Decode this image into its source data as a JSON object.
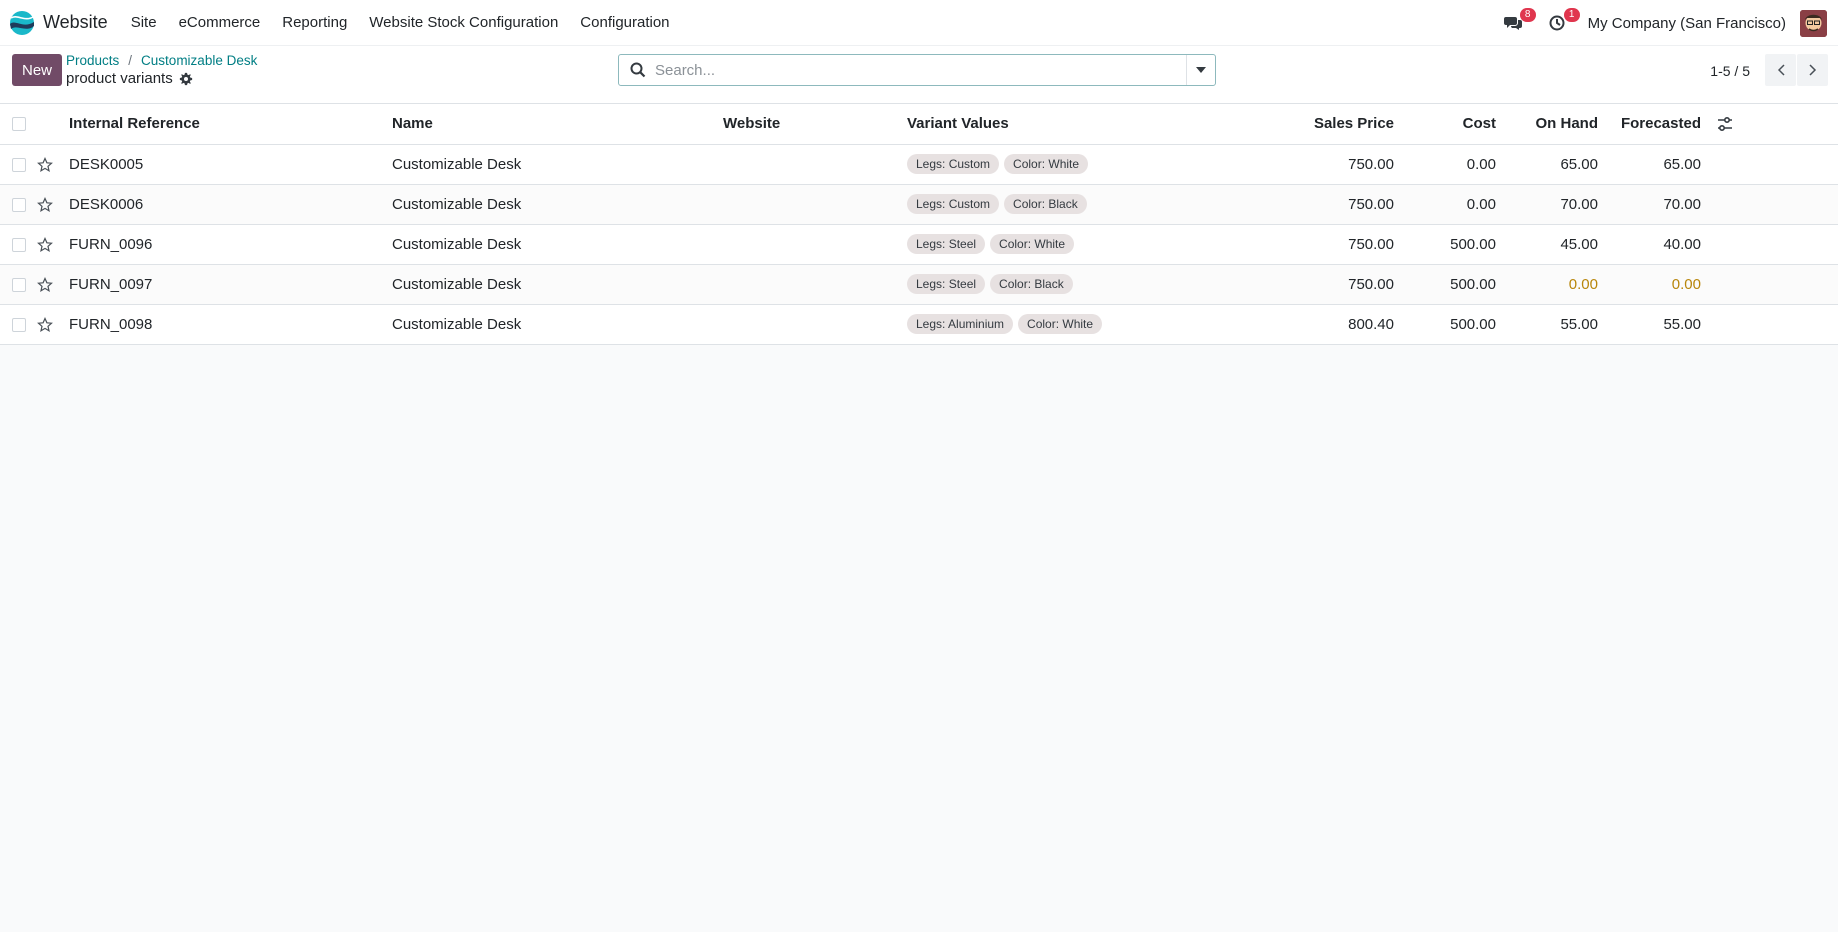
{
  "navbar": {
    "app_name": "Website",
    "menu": [
      "Site",
      "eCommerce",
      "Reporting",
      "Website Stock Configuration",
      "Configuration"
    ],
    "messages_badge": "8",
    "activities_badge": "1",
    "company": "My Company (San Francisco)"
  },
  "control_panel": {
    "new_label": "New",
    "breadcrumb": [
      "Products",
      "Customizable Desk"
    ],
    "breadcrumb_sep": "/",
    "title": "product variants",
    "search_placeholder": "Search...",
    "pager": "1-5 / 5"
  },
  "table": {
    "headers": {
      "ref": "Internal Reference",
      "name": "Name",
      "website": "Website",
      "variants": "Variant Values",
      "price": "Sales Price",
      "cost": "Cost",
      "onhand": "On Hand",
      "forecast": "Forecasted"
    },
    "rows": [
      {
        "ref": "DESK0005",
        "name": "Customizable Desk",
        "website": "",
        "tags": [
          "Legs: Custom",
          "Color: White"
        ],
        "price": "750.00",
        "cost": "0.00",
        "onhand": "65.00",
        "forecast": "65.00"
      },
      {
        "ref": "DESK0006",
        "name": "Customizable Desk",
        "website": "",
        "tags": [
          "Legs: Custom",
          "Color: Black"
        ],
        "price": "750.00",
        "cost": "0.00",
        "onhand": "70.00",
        "forecast": "70.00"
      },
      {
        "ref": "FURN_0096",
        "name": "Customizable Desk",
        "website": "",
        "tags": [
          "Legs: Steel",
          "Color: White"
        ],
        "price": "750.00",
        "cost": "500.00",
        "onhand": "45.00",
        "forecast": "40.00"
      },
      {
        "ref": "FURN_0097",
        "name": "Customizable Desk",
        "website": "",
        "tags": [
          "Legs: Steel",
          "Color: Black"
        ],
        "price": "750.00",
        "cost": "500.00",
        "onhand": "0.00",
        "forecast": "0.00"
      },
      {
        "ref": "FURN_0098",
        "name": "Customizable Desk",
        "website": "",
        "tags": [
          "Legs: Aluminium",
          "Color: White"
        ],
        "price": "800.40",
        "cost": "500.00",
        "onhand": "55.00",
        "forecast": "55.00"
      }
    ]
  },
  "colors": {
    "brand": "#714b67",
    "link": "#017e84",
    "warning_qty": "#b8860b",
    "badge": "#e0364e"
  }
}
